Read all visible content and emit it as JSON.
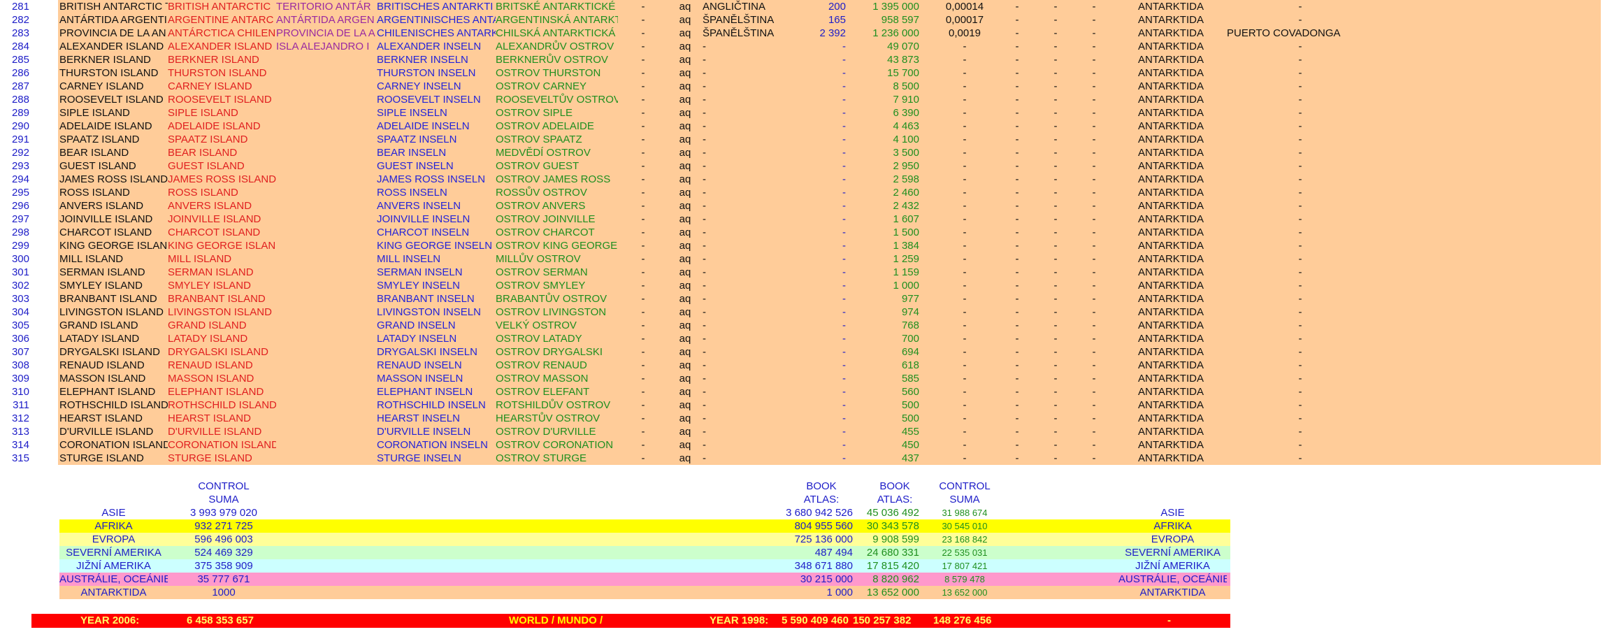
{
  "rows": [
    {
      "num": "281",
      "en": "BRITISH ANTARCTIC T",
      "es": "BRITISH ANTARCTIC",
      "es2": "TERITORIO ANTÁR",
      "de": "BRITISCHES ANTARKTI",
      "cz": "BRITSKÉ ANTARKTICKÉ",
      "d1": "-",
      "code": "aq",
      "lang": "ANGLIČTINA",
      "pop": "200",
      "area": "1 395 000",
      "dens": "0,00014",
      "d2": "-",
      "d3": "-",
      "d4": "-",
      "cont": "ANTARKTIDA",
      "cap": "-"
    },
    {
      "num": "282",
      "en": "ANTÁRTIDA ARGENTI",
      "es": "ARGENTINE ANTARC",
      "es2": "ANTÁRTIDA ARGEN",
      "de": "ARGENTINISCHES ANTA",
      "cz": "ARGENTINSKÁ ANTARKTI",
      "d1": "-",
      "code": "aq",
      "lang": "ŠPANĚLŠTINA",
      "pop": "165",
      "area": "958 597",
      "dens": "0,00017",
      "d2": "-",
      "d3": "-",
      "d4": "-",
      "cont": "ANTARKTIDA",
      "cap": "-"
    },
    {
      "num": "283",
      "en": "PROVINCIA DE LA AN",
      "es": "ANTÁRCTICA CHILEN",
      "es2": "PROVINCIA DE LA A",
      "de": "CHILENISCHES ANTARK",
      "cz": "CHILSKÁ ANTARKTICKÁ",
      "d1": "-",
      "code": "aq",
      "lang": "ŠPANĚLŠTINA",
      "pop": "2 392",
      "area": "1 236 000",
      "dens": "0,0019",
      "d2": "-",
      "d3": "-",
      "d4": "-",
      "cont": "ANTARKTIDA",
      "cap": "PUERTO COVADONGA"
    },
    {
      "num": "284",
      "en": "ALEXANDER ISLAND",
      "es": "ALEXANDER ISLAND",
      "es2": "ISLA ALEJANDRO I",
      "de": "ALEXANDER INSELN",
      "cz": "ALEXANDRŮV OSTROV",
      "d1": "-",
      "code": "aq",
      "lang": "-",
      "pop": "-",
      "area": "49 070",
      "dens": "-",
      "d2": "-",
      "d3": "-",
      "d4": "-",
      "cont": "ANTARKTIDA",
      "cap": "-"
    },
    {
      "num": "285",
      "en": "BERKNER ISLAND",
      "es": "BERKNER ISLAND",
      "es2": "",
      "de": "BERKNER INSELN",
      "cz": "BERKNERŮV OSTROV",
      "d1": "-",
      "code": "aq",
      "lang": "-",
      "pop": "-",
      "area": "43 873",
      "dens": "-",
      "d2": "-",
      "d3": "-",
      "d4": "-",
      "cont": "ANTARKTIDA",
      "cap": "-"
    },
    {
      "num": "286",
      "en": "THURSTON ISLAND",
      "es": "THURSTON ISLAND",
      "es2": "",
      "de": "THURSTON INSELN",
      "cz": "OSTROV THURSTON",
      "d1": "-",
      "code": "aq",
      "lang": "-",
      "pop": "-",
      "area": "15 700",
      "dens": "-",
      "d2": "-",
      "d3": "-",
      "d4": "-",
      "cont": "ANTARKTIDA",
      "cap": "-"
    },
    {
      "num": "287",
      "en": "CARNEY ISLAND",
      "es": "CARNEY ISLAND",
      "es2": "",
      "de": "CARNEY INSELN",
      "cz": "OSTROV CARNEY",
      "d1": "-",
      "code": "aq",
      "lang": "-",
      "pop": "-",
      "area": "8 500",
      "dens": "-",
      "d2": "-",
      "d3": "-",
      "d4": "-",
      "cont": "ANTARKTIDA",
      "cap": "-"
    },
    {
      "num": "288",
      "en": "ROOSEVELT ISLAND",
      "es": "ROOSEVELT ISLAND",
      "es2": "",
      "de": "ROOSEVELT INSELN",
      "cz": "ROOSEVELTŮV OSTROV",
      "d1": "-",
      "code": "aq",
      "lang": "-",
      "pop": "-",
      "area": "7 910",
      "dens": "-",
      "d2": "-",
      "d3": "-",
      "d4": "-",
      "cont": "ANTARKTIDA",
      "cap": "-"
    },
    {
      "num": "289",
      "en": "SIPLE ISLAND",
      "es": "SIPLE ISLAND",
      "es2": "",
      "de": "SIPLE INSELN",
      "cz": "OSTROV SIPLE",
      "d1": "-",
      "code": "aq",
      "lang": "-",
      "pop": "-",
      "area": "6 390",
      "dens": "-",
      "d2": "-",
      "d3": "-",
      "d4": "-",
      "cont": "ANTARKTIDA",
      "cap": "-"
    },
    {
      "num": "290",
      "en": "ADELAIDE ISLAND",
      "es": "ADELAIDE ISLAND",
      "es2": "",
      "de": "ADELAIDE INSELN",
      "cz": "OSTROV ADELAIDE",
      "d1": "-",
      "code": "aq",
      "lang": "-",
      "pop": "-",
      "area": "4 463",
      "dens": "-",
      "d2": "-",
      "d3": "-",
      "d4": "-",
      "cont": "ANTARKTIDA",
      "cap": "-"
    },
    {
      "num": "291",
      "en": "SPAATZ ISLAND",
      "es": "SPAATZ ISLAND",
      "es2": "",
      "de": "SPAATZ INSELN",
      "cz": "OSTROV SPAATZ",
      "d1": "-",
      "code": "aq",
      "lang": "-",
      "pop": "-",
      "area": "4 100",
      "dens": "-",
      "d2": "-",
      "d3": "-",
      "d4": "-",
      "cont": "ANTARKTIDA",
      "cap": "-"
    },
    {
      "num": "292",
      "en": "BEAR ISLAND",
      "es": "BEAR ISLAND",
      "es2": "",
      "de": "BEAR INSELN",
      "cz": "MEDVĚDÍ OSTROV",
      "d1": "-",
      "code": "aq",
      "lang": "-",
      "pop": "-",
      "area": "3 500",
      "dens": "-",
      "d2": "-",
      "d3": "-",
      "d4": "-",
      "cont": "ANTARKTIDA",
      "cap": "-"
    },
    {
      "num": "293",
      "en": "GUEST ISLAND",
      "es": "GUEST ISLAND",
      "es2": "",
      "de": "GUEST INSELN",
      "cz": "OSTROV GUEST",
      "d1": "-",
      "code": "aq",
      "lang": "-",
      "pop": "-",
      "area": "2 950",
      "dens": "-",
      "d2": "-",
      "d3": "-",
      "d4": "-",
      "cont": "ANTARKTIDA",
      "cap": "-"
    },
    {
      "num": "294",
      "en": "JAMES ROSS ISLAND",
      "es": "JAMES ROSS ISLAND",
      "es2": "",
      "de": "JAMES ROSS INSELN",
      "cz": "OSTROV JAMES ROSS",
      "d1": "-",
      "code": "aq",
      "lang": "-",
      "pop": "-",
      "area": "2 598",
      "dens": "-",
      "d2": "-",
      "d3": "-",
      "d4": "-",
      "cont": "ANTARKTIDA",
      "cap": "-"
    },
    {
      "num": "295",
      "en": "ROSS ISLAND",
      "es": "ROSS ISLAND",
      "es2": "",
      "de": "ROSS INSELN",
      "cz": "ROSSŮV OSTROV",
      "d1": "-",
      "code": "aq",
      "lang": "-",
      "pop": "-",
      "area": "2 460",
      "dens": "-",
      "d2": "-",
      "d3": "-",
      "d4": "-",
      "cont": "ANTARKTIDA",
      "cap": "-"
    },
    {
      "num": "296",
      "en": "ANVERS ISLAND",
      "es": "ANVERS ISLAND",
      "es2": "",
      "de": "ANVERS INSELN",
      "cz": "OSTROV ANVERS",
      "d1": "-",
      "code": "aq",
      "lang": "-",
      "pop": "-",
      "area": "2 432",
      "dens": "-",
      "d2": "-",
      "d3": "-",
      "d4": "-",
      "cont": "ANTARKTIDA",
      "cap": "-"
    },
    {
      "num": "297",
      "en": "JOINVILLE ISLAND",
      "es": "JOINVILLE ISLAND",
      "es2": "",
      "de": "JOINVILLE INSELN",
      "cz": "OSTROV JOINVILLE",
      "d1": "-",
      "code": "aq",
      "lang": "-",
      "pop": "-",
      "area": "1 607",
      "dens": "-",
      "d2": "-",
      "d3": "-",
      "d4": "-",
      "cont": "ANTARKTIDA",
      "cap": "-"
    },
    {
      "num": "298",
      "en": "CHARCOT ISLAND",
      "es": "CHARCOT ISLAND",
      "es2": "",
      "de": "CHARCOT INSELN",
      "cz": "OSTROV CHARCOT",
      "d1": "-",
      "code": "aq",
      "lang": "-",
      "pop": "-",
      "area": "1 500",
      "dens": "-",
      "d2": "-",
      "d3": "-",
      "d4": "-",
      "cont": "ANTARKTIDA",
      "cap": "-"
    },
    {
      "num": "299",
      "en": "KING GEORGE ISLAN",
      "es": "KING GEORGE ISLAND",
      "es2": "",
      "de": "KING GEORGE INSELN",
      "cz": "OSTROV KING GEORGE",
      "d1": "-",
      "code": "aq",
      "lang": "-",
      "pop": "-",
      "area": "1 384",
      "dens": "-",
      "d2": "-",
      "d3": "-",
      "d4": "-",
      "cont": "ANTARKTIDA",
      "cap": "-"
    },
    {
      "num": "300",
      "en": "MILL ISLAND",
      "es": "MILL ISLAND",
      "es2": "",
      "de": "MILL INSELN",
      "cz": "MILLŮV OSTROV",
      "d1": "-",
      "code": "aq",
      "lang": "-",
      "pop": "-",
      "area": "1 259",
      "dens": "-",
      "d2": "-",
      "d3": "-",
      "d4": "-",
      "cont": "ANTARKTIDA",
      "cap": "-"
    },
    {
      "num": "301",
      "en": "SERMAN ISLAND",
      "es": "SERMAN ISLAND",
      "es2": "",
      "de": "SERMAN INSELN",
      "cz": "OSTROV SERMAN",
      "d1": "-",
      "code": "aq",
      "lang": "-",
      "pop": "-",
      "area": "1 159",
      "dens": "-",
      "d2": "-",
      "d3": "-",
      "d4": "-",
      "cont": "ANTARKTIDA",
      "cap": "-"
    },
    {
      "num": "302",
      "en": "SMYLEY ISLAND",
      "es": "SMYLEY ISLAND",
      "es2": "",
      "de": "SMYLEY INSELN",
      "cz": "OSTROV SMYLEY",
      "d1": "-",
      "code": "aq",
      "lang": "-",
      "pop": "-",
      "area": "1 000",
      "dens": "-",
      "d2": "-",
      "d3": "-",
      "d4": "-",
      "cont": "ANTARKTIDA",
      "cap": "-"
    },
    {
      "num": "303",
      "en": "BRANBANT ISLAND",
      "es": "BRANBANT ISLAND",
      "es2": "",
      "de": "BRANBANT INSELN",
      "cz": "BRABANTŮV OSTROV",
      "d1": "-",
      "code": "aq",
      "lang": "-",
      "pop": "-",
      "area": "977",
      "dens": "-",
      "d2": "-",
      "d3": "-",
      "d4": "-",
      "cont": "ANTARKTIDA",
      "cap": "-"
    },
    {
      "num": "304",
      "en": "LIVINGSTON ISLAND",
      "es": "LIVINGSTON ISLAND",
      "es2": "",
      "de": "LIVINGSTON INSELN",
      "cz": "OSTROV LIVINGSTON",
      "d1": "-",
      "code": "aq",
      "lang": "-",
      "pop": "-",
      "area": "974",
      "dens": "-",
      "d2": "-",
      "d3": "-",
      "d4": "-",
      "cont": "ANTARKTIDA",
      "cap": "-"
    },
    {
      "num": "305",
      "en": "GRAND ISLAND",
      "es": "GRAND ISLAND",
      "es2": "",
      "de": "GRAND INSELN",
      "cz": "VELKÝ OSTROV",
      "d1": "-",
      "code": "aq",
      "lang": "-",
      "pop": "-",
      "area": "768",
      "dens": "-",
      "d2": "-",
      "d3": "-",
      "d4": "-",
      "cont": "ANTARKTIDA",
      "cap": "-"
    },
    {
      "num": "306",
      "en": "LATADY ISLAND",
      "es": "LATADY ISLAND",
      "es2": "",
      "de": "LATADY INSELN",
      "cz": "OSTROV LATADY",
      "d1": "-",
      "code": "aq",
      "lang": "-",
      "pop": "-",
      "area": "700",
      "dens": "-",
      "d2": "-",
      "d3": "-",
      "d4": "-",
      "cont": "ANTARKTIDA",
      "cap": "-"
    },
    {
      "num": "307",
      "en": "DRYGALSKI ISLAND",
      "es": "DRYGALSKI ISLAND",
      "es2": "",
      "de": "DRYGALSKI INSELN",
      "cz": "OSTROV DRYGALSKI",
      "d1": "-",
      "code": "aq",
      "lang": "-",
      "pop": "-",
      "area": "694",
      "dens": "-",
      "d2": "-",
      "d3": "-",
      "d4": "-",
      "cont": "ANTARKTIDA",
      "cap": "-"
    },
    {
      "num": "308",
      "en": "RENAUD ISLAND",
      "es": "RENAUD ISLAND",
      "es2": "",
      "de": "RENAUD INSELN",
      "cz": "OSTROV RENAUD",
      "d1": "-",
      "code": "aq",
      "lang": "-",
      "pop": "-",
      "area": "618",
      "dens": "-",
      "d2": "-",
      "d3": "-",
      "d4": "-",
      "cont": "ANTARKTIDA",
      "cap": "-"
    },
    {
      "num": "309",
      "en": "MASSON ISLAND",
      "es": "MASSON ISLAND",
      "es2": "",
      "de": "MASSON INSELN",
      "cz": "OSTROV MASSON",
      "d1": "-",
      "code": "aq",
      "lang": "-",
      "pop": "-",
      "area": "585",
      "dens": "-",
      "d2": "-",
      "d3": "-",
      "d4": "-",
      "cont": "ANTARKTIDA",
      "cap": "-"
    },
    {
      "num": "310",
      "en": "ELEPHANT ISLAND",
      "es": "ELEPHANT ISLAND",
      "es2": "",
      "de": "ELEPHANT INSELN",
      "cz": "OSTROV ELEFANT",
      "d1": "-",
      "code": "aq",
      "lang": "-",
      "pop": "-",
      "area": "560",
      "dens": "-",
      "d2": "-",
      "d3": "-",
      "d4": "-",
      "cont": "ANTARKTIDA",
      "cap": "-"
    },
    {
      "num": "311",
      "en": "ROTHSCHILD ISLAND",
      "es": "ROTHSCHILD ISLAND",
      "es2": "",
      "de": "ROTHSCHILD INSELN",
      "cz": "ROTSHILDŮV OSTROV",
      "d1": "-",
      "code": "aq",
      "lang": "-",
      "pop": "-",
      "area": "500",
      "dens": "-",
      "d2": "-",
      "d3": "-",
      "d4": "-",
      "cont": "ANTARKTIDA",
      "cap": "-"
    },
    {
      "num": "312",
      "en": "HEARST ISLAND",
      "es": "HEARST ISLAND",
      "es2": "",
      "de": "HEARST INSELN",
      "cz": "HEARSTŮV OSTROV",
      "d1": "-",
      "code": "aq",
      "lang": "-",
      "pop": "-",
      "area": "500",
      "dens": "-",
      "d2": "-",
      "d3": "-",
      "d4": "-",
      "cont": "ANTARKTIDA",
      "cap": "-"
    },
    {
      "num": "313",
      "en": "D'URVILLE ISLAND",
      "es": "D'URVILLE ISLAND",
      "es2": "",
      "de": "D'URVILLE INSELN",
      "cz": "OSTROV D'URVILLE",
      "d1": "-",
      "code": "aq",
      "lang": "-",
      "pop": "-",
      "area": "455",
      "dens": "-",
      "d2": "-",
      "d3": "-",
      "d4": "-",
      "cont": "ANTARKTIDA",
      "cap": "-"
    },
    {
      "num": "314",
      "en": "CORONATION ISLAND",
      "es": "CORONATION ISLAND",
      "es2": "",
      "de": "CORONATION INSELN",
      "cz": "OSTROV CORONATION",
      "d1": "-",
      "code": "aq",
      "lang": "-",
      "pop": "-",
      "area": "450",
      "dens": "-",
      "d2": "-",
      "d3": "-",
      "d4": "-",
      "cont": "ANTARKTIDA",
      "cap": "-"
    },
    {
      "num": "315",
      "en": "STURGE ISLAND",
      "es": "STURGE ISLAND",
      "es2": "",
      "de": "STURGE INSELN",
      "cz": "OSTROV STURGE",
      "d1": "-",
      "code": "aq",
      "lang": "-",
      "pop": "-",
      "area": "437",
      "dens": "-",
      "d2": "-",
      "d3": "-",
      "d4": "-",
      "cont": "ANTARKTIDA",
      "cap": "-"
    }
  ],
  "summary_headers": {
    "control_top": "CONTROL",
    "suma_left": "SUMA",
    "book1_top": "BOOK",
    "book1_bottom": "ATLAS:",
    "book2_top": "BOOK",
    "book2_bottom": "ATLAS:",
    "control2_top": "CONTROL",
    "control2_bottom": "SUMA"
  },
  "summary": [
    {
      "name": "ASIE",
      "control": "3 993 979 020",
      "book1": "3 680 942 526",
      "book2": "45 036 492",
      "csum": "31 988 674",
      "name2": "ASIE",
      "color": "#ffffff"
    },
    {
      "name": "AFRIKA",
      "control": "932 271 725",
      "book1": "804 955 560",
      "book2": "30 343 578",
      "csum": "30 545 010",
      "name2": "AFRIKA",
      "color": "#ffff00"
    },
    {
      "name": "EVROPA",
      "control": "596 496 003",
      "book1": "725 136 000",
      "book2": "9 908 599",
      "csum": "23 168 842",
      "name2": "EVROPA",
      "color": "#ffff99"
    },
    {
      "name": "SEVERNÍ AMERIKA",
      "control": "524 469 329",
      "book1": "487 494",
      "book2": "24 680 331",
      "csum": "22 535 031",
      "name2": "SEVERNÍ AMERIKA",
      "color": "#ccffcc"
    },
    {
      "name": "JIŽNÍ AMERIKA",
      "control": "375 358 909",
      "book1": "348 671 880",
      "book2": "17 815 420",
      "csum": "17 807 421",
      "name2": "JIŽNÍ AMERIKA",
      "color": "#ccffff"
    },
    {
      "name": "AUSTRÁLIE, OCEÁNIE",
      "control": "35 777 671",
      "book1": "30 215 000",
      "book2": "8 820 962",
      "csum": "8 579 478",
      "name2": "AUSTRÁLIE, OCEÁNIE",
      "color": "#ff99cc"
    },
    {
      "name": "ANTARKTIDA",
      "control": "1000",
      "book1": "1 000",
      "book2": "13 652 000",
      "csum": "13 652 000",
      "name2": "ANTARKTIDA",
      "color": "#ffcc99"
    }
  ],
  "footer": {
    "year2006_label": "YEAR  2006:",
    "year2006_value": "6 458 353 657",
    "world": "WORLD  /  MUNDO  /",
    "year1998_label": "YEAR  1998:",
    "year1998_value": "5 590 409 460",
    "book_total": "150 257 382",
    "control_total": "148 276 456",
    "dash": "-"
  },
  "colors": {
    "row_bg": "#ffcc99",
    "footer_bg": "#ff0000",
    "footer_text": "#ffff66"
  }
}
